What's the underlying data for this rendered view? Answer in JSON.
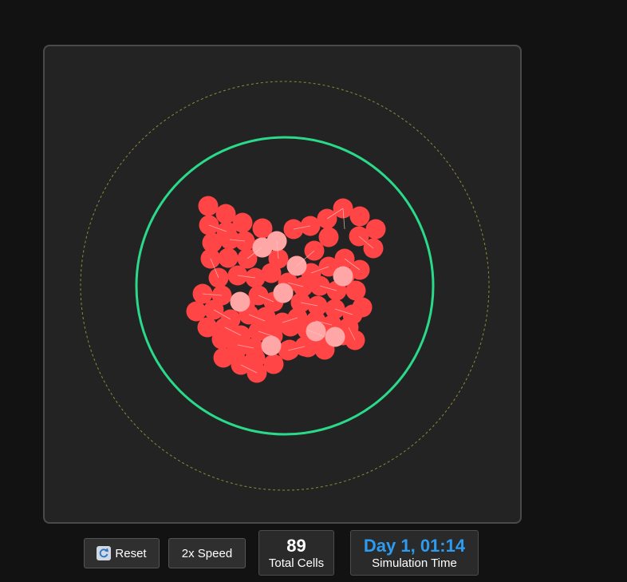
{
  "controls": {
    "reset_icon": "refresh-icon",
    "reset_label": "Reset",
    "speed_label": "2x Speed"
  },
  "stats": {
    "cells_value": "89",
    "cells_label": "Total Cells",
    "time_value": "Day 1, 01:14",
    "time_label": "Simulation Time"
  },
  "colors": {
    "background": "#121212",
    "panel": "#232323",
    "panel_border": "#4a4a4a",
    "boundary_ring": "#2bd98a",
    "outer_ring_dashed": "#8f8a3a",
    "cell": "#ff4545",
    "cell_dividing": "#ffa6a6",
    "cell_link": "#ffc2c2",
    "time_value": "#2d9cf0"
  }
}
